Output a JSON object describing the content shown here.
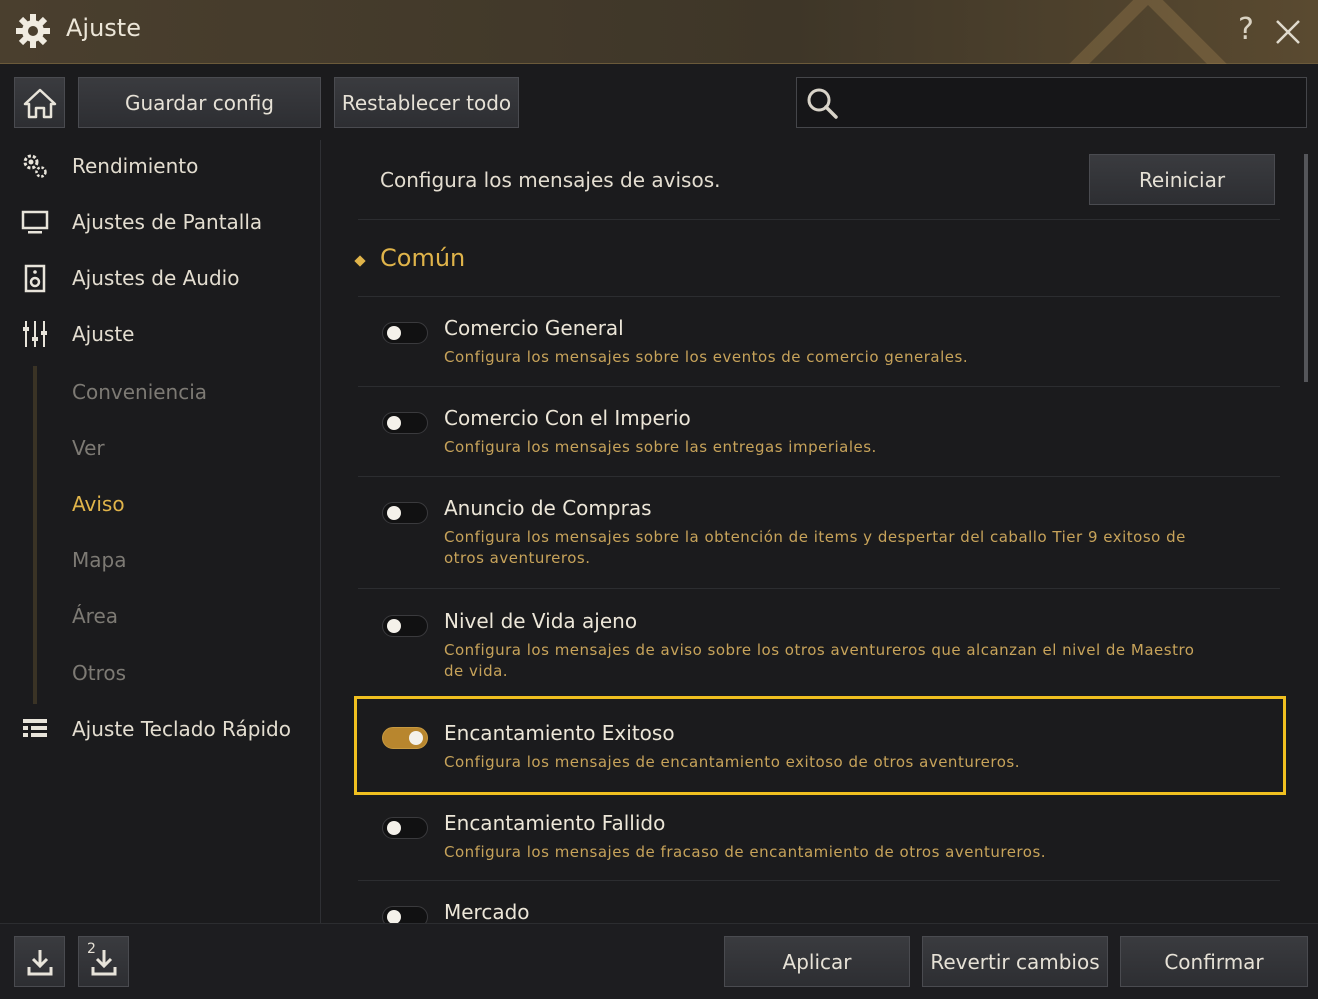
{
  "window": {
    "title": "Ajuste",
    "help_label": "?"
  },
  "toolbar": {
    "save_label": "Guardar config",
    "reset_all_label": "Restablecer todo",
    "search_placeholder": "",
    "search_value": ""
  },
  "sidebar": {
    "items": [
      {
        "label": "Rendimiento",
        "icon": "gears-icon"
      },
      {
        "label": "Ajustes de Pantalla",
        "icon": "monitor-icon"
      },
      {
        "label": "Ajustes de Audio",
        "icon": "speaker-icon"
      },
      {
        "label": "Ajuste",
        "icon": "sliders-icon"
      },
      {
        "label": "Ajuste Teclado Rápido",
        "icon": "list-icon"
      }
    ],
    "subitems": [
      {
        "label": "Conveniencia",
        "active": false
      },
      {
        "label": "Ver",
        "active": false
      },
      {
        "label": "Aviso",
        "active": true
      },
      {
        "label": "Mapa",
        "active": false
      },
      {
        "label": "Área",
        "active": false
      },
      {
        "label": "Otros",
        "active": false
      }
    ]
  },
  "main": {
    "description": "Configura los mensajes de avisos.",
    "reset_label": "Reiniciar",
    "section_title": "Común",
    "options": [
      {
        "title": "Comercio General",
        "desc": "Configura los mensajes sobre los eventos de comercio generales.",
        "enabled": false
      },
      {
        "title": "Comercio Con el Imperio",
        "desc": "Configura los mensajes sobre las entregas imperiales.",
        "enabled": false
      },
      {
        "title": "Anuncio de Compras",
        "desc": "Configura los mensajes sobre la obtención de items y despertar del caballo Tier 9 exitoso de otros aventureros.",
        "enabled": false
      },
      {
        "title": "Nivel de Vida ajeno",
        "desc": "Configura los mensajes de aviso sobre los otros aventureros que alcanzan el nivel de Maestro de vida.",
        "enabled": false
      },
      {
        "title": "Encantamiento Exitoso",
        "desc": "Configura los mensajes de encantamiento exitoso de otros aventureros.",
        "enabled": true
      },
      {
        "title": "Encantamiento Fallido",
        "desc": "Configura los mensajes de fracaso de encantamiento de otros aventureros.",
        "enabled": false
      },
      {
        "title": "Mercado",
        "desc": "",
        "enabled": false
      }
    ]
  },
  "bottom": {
    "apply_label": "Aplicar",
    "revert_label": "Revertir cambios",
    "confirm_label": "Confirmar",
    "slot2_label": "2"
  },
  "colors": {
    "accent": "#e0b44a",
    "highlight": "#f0c020",
    "toggle_on": "#b8862e"
  }
}
